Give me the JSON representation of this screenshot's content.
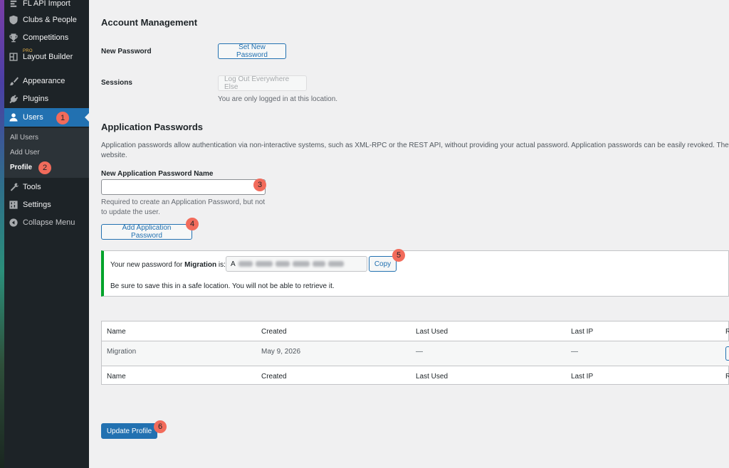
{
  "sidebar": {
    "items": [
      {
        "label": "FL API Import",
        "icon": "api-import-icon"
      },
      {
        "label": "Clubs & People",
        "icon": "shield-icon"
      },
      {
        "label": "Competitions",
        "icon": "trophy-icon"
      },
      {
        "label": "Layout Builder",
        "icon": "layout-icon",
        "tag": "PRO"
      },
      {
        "label": "Appearance",
        "icon": "brush-icon"
      },
      {
        "label": "Plugins",
        "icon": "plug-icon"
      },
      {
        "label": "Users",
        "icon": "user-icon"
      },
      {
        "label": "Tools",
        "icon": "wrench-icon"
      },
      {
        "label": "Settings",
        "icon": "settings-sliders-icon"
      },
      {
        "label": "Collapse Menu",
        "icon": "collapse-icon"
      }
    ],
    "submenu": [
      "All Users",
      "Add User",
      "Profile"
    ]
  },
  "account": {
    "title": "Account Management",
    "new_password_label": "New Password",
    "set_password_button": "Set New Password",
    "sessions_label": "Sessions",
    "logout_button": "Log Out Everywhere Else",
    "sessions_note": "You are only logged in at this location."
  },
  "app_passwords": {
    "title": "Application Passwords",
    "description_line1": "Application passwords allow authentication via non-interactive systems, such as XML-RPC or the REST API, without providing your actual password. Application passwords can be easily revoked. They canno",
    "description_line2": "website.",
    "name_label": "New Application Password Name",
    "name_value": "",
    "help_line1": "Required to create an Application Password, but not",
    "help_line2": "to update the user.",
    "add_button": "Add Application Password",
    "notice_prefix": "Your new password for ",
    "notice_name": "Migration",
    "notice_suffix": " is:",
    "password_first_char": "A",
    "copy_button": "Copy",
    "notice_warning": "Be sure to save this in a safe location. You will not be able to retrieve it."
  },
  "table": {
    "columns": [
      "Name",
      "Created",
      "Last Used",
      "Last IP",
      "R"
    ],
    "rows": [
      {
        "name": "Migration",
        "created": "May 9, 2026",
        "last_used": "—",
        "last_ip": "—"
      }
    ]
  },
  "update_button": "Update Profile",
  "badges": [
    "1",
    "2",
    "3",
    "4",
    "5",
    "6"
  ],
  "colors": {
    "accent": "#2271b1",
    "sidebar": "#1d2327",
    "badge": "#f26b5b",
    "success": "#00a32a"
  }
}
